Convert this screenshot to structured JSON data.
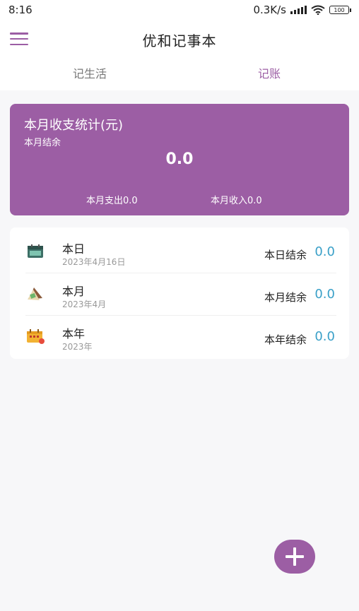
{
  "status_bar": {
    "time": "8:16",
    "network_speed": "0.3K/s",
    "battery": "100",
    "icons": [
      "signal-icon",
      "wifi-icon",
      "battery-icon"
    ]
  },
  "app_bar": {
    "title": "优和记事本",
    "menu_icon": "menu-icon"
  },
  "tabs": [
    {
      "label": "记生活",
      "active": false
    },
    {
      "label": "记账",
      "active": true
    }
  ],
  "summary": {
    "title": "本月收支统计(元)",
    "balance_label": "本月结余",
    "balance_value": "0.0",
    "expense": "本月支出0.0",
    "income": "本月收入0.0"
  },
  "rows": [
    {
      "icon": "calendar-day-icon",
      "title": "本日",
      "date": "2023年4月16日",
      "label": "本日结余",
      "value": "0.0"
    },
    {
      "icon": "calendar-month-icon",
      "title": "本月",
      "date": "2023年4月",
      "label": "本月结余",
      "value": "0.0"
    },
    {
      "icon": "calendar-year-icon",
      "title": "本年",
      "date": "2023年",
      "label": "本年结余",
      "value": "0.0"
    }
  ],
  "fab": {
    "icon": "plus-icon"
  },
  "colors": {
    "accent": "#9c5ea4",
    "value_blue": "#3aa0c8"
  }
}
